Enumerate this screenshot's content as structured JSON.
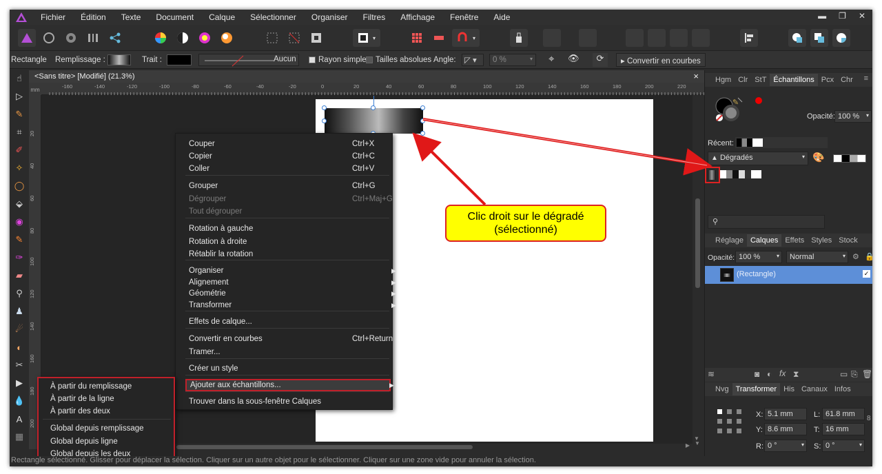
{
  "menu": [
    "Fichier",
    "Édition",
    "Texte",
    "Document",
    "Calque",
    "Sélectionner",
    "Organiser",
    "Filtres",
    "Affichage",
    "Fenêtre",
    "Aide"
  ],
  "ctx": {
    "tool": "Rectangle",
    "fill": "Remplissage :",
    "stroke": "Trait :",
    "none": "Aucun",
    "simple_radius": "Rayon simple",
    "abs_sizes": "Tailles absolues",
    "angle": "Angle:",
    "angle_val": "0 %",
    "convert": "Convertir en courbes"
  },
  "doc": {
    "tab": "<Sans titre> [Modifié] (21.3%)",
    "close": "×",
    "ruler_unit": "mm",
    "hticks": [
      "-160",
      "-140",
      "-120",
      "-100",
      "-80",
      "-60",
      "-40",
      "-20",
      "0",
      "20",
      "40",
      "60",
      "80",
      "100",
      "120",
      "140",
      "160",
      "180",
      "200",
      "220"
    ],
    "vticks": [
      "20",
      "40",
      "60",
      "80",
      "100",
      "120",
      "140",
      "160",
      "180",
      "200"
    ]
  },
  "context_menu": [
    {
      "label": "Couper",
      "shortcut": "Ctrl+X"
    },
    {
      "label": "Copier",
      "shortcut": "Ctrl+C"
    },
    {
      "label": "Coller",
      "shortcut": "Ctrl+V"
    },
    {
      "label": "Grouper",
      "shortcut": "Ctrl+G"
    },
    {
      "label": "Dégrouper",
      "shortcut": "Ctrl+Maj+G"
    },
    {
      "label": "Tout dégrouper",
      "shortcut": ""
    },
    {
      "label": "Rotation à gauche",
      "shortcut": ""
    },
    {
      "label": "Rotation à droite",
      "shortcut": ""
    },
    {
      "label": "Rétablir la rotation",
      "shortcut": ""
    },
    {
      "label": "Organiser",
      "shortcut": ""
    },
    {
      "label": "Alignement",
      "shortcut": ""
    },
    {
      "label": "Géométrie",
      "shortcut": ""
    },
    {
      "label": "Transformer",
      "shortcut": ""
    },
    {
      "label": "Effets de calque...",
      "shortcut": ""
    },
    {
      "label": "Convertir en courbes",
      "shortcut": "Ctrl+Return"
    },
    {
      "label": "Tramer...",
      "shortcut": ""
    },
    {
      "label": "Créer un style",
      "shortcut": ""
    },
    {
      "label": "Ajouter aux échantillons...",
      "shortcut": ""
    },
    {
      "label": "Trouver dans la sous-fenêtre Calques",
      "shortcut": ""
    }
  ],
  "submenu": [
    "À partir du remplissage",
    "À partir de la ligne",
    "À partir des deux",
    "Global depuis remplissage",
    "Global depuis ligne",
    "Global depuis les deux"
  ],
  "callout": {
    "line1": "Clic droit sur le dégradé",
    "line2": "(sélectionné)"
  },
  "panel_top": {
    "tabs": [
      "Hgm",
      "Clr",
      "StT",
      "Échantillons",
      "Pcx",
      "Chr"
    ],
    "opacity_label": "Opacité:",
    "opacity": "100 %",
    "recent": "Récent:",
    "category": "Dégradés"
  },
  "panel_mid": {
    "tabs": [
      "Réglage",
      "Calques",
      "Effets",
      "Styles",
      "Stock"
    ],
    "opacity_label": "Opacité:",
    "opacity": "100 %",
    "blend": "Normal",
    "layer": "(Rectangle)"
  },
  "panel_bot": {
    "tabs": [
      "Nvg",
      "Transformer",
      "His",
      "Canaux",
      "Infos"
    ],
    "x_label": "X:",
    "x": "5.1 mm",
    "w_label": "L:",
    "w": "61.8 mm",
    "y_label": "Y:",
    "y": "8.6 mm",
    "h_label": "T:",
    "h": "16 mm",
    "r_label": "R:",
    "r": "0 °",
    "s_label": "S:",
    "s": "0 °"
  },
  "status": "Rectangle sélectionné. Glisser pour déplacer la sélection. Cliquer sur un autre objet pour le sélectionner. Cliquer sur une zone vide pour annuler la sélection.",
  "colors": {
    "accent": "#3b7fd4",
    "callout_bg": "#ffff00",
    "callout_border": "#dd2222"
  }
}
